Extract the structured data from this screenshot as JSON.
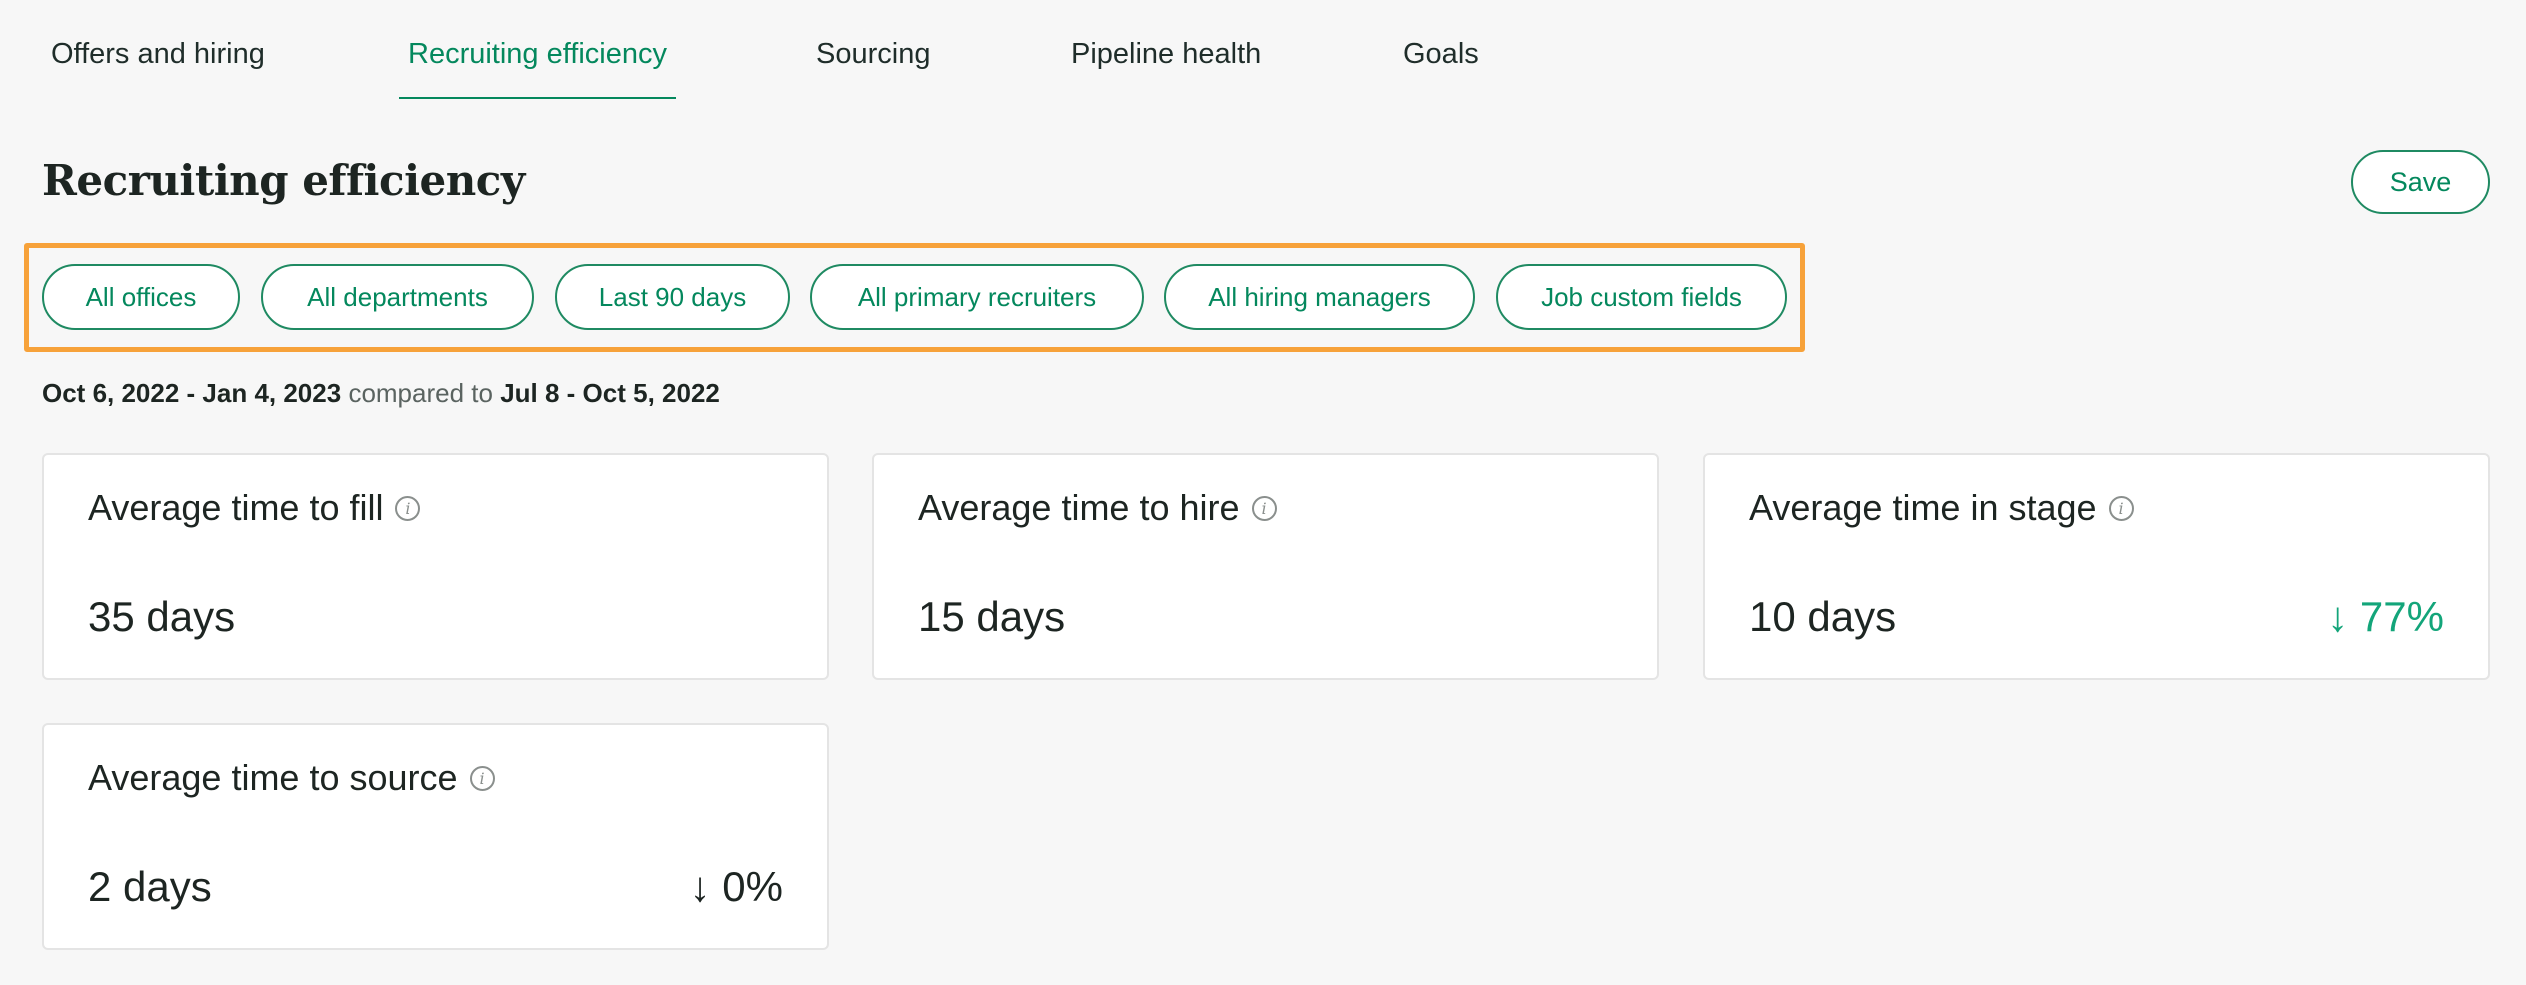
{
  "tabs": [
    {
      "label": "Offers and hiring",
      "active": false
    },
    {
      "label": "Recruiting efficiency",
      "active": true
    },
    {
      "label": "Sourcing",
      "active": false
    },
    {
      "label": "Pipeline health",
      "active": false
    },
    {
      "label": "Goals",
      "active": false
    }
  ],
  "page": {
    "title": "Recruiting efficiency",
    "save_label": "Save"
  },
  "filters": [
    {
      "label": "All offices"
    },
    {
      "label": "All departments"
    },
    {
      "label": "Last 90 days"
    },
    {
      "label": "All primary recruiters"
    },
    {
      "label": "All hiring managers"
    },
    {
      "label": "Job custom fields"
    }
  ],
  "date_range": {
    "current": "Oct 6, 2022 - Jan 4, 2023",
    "separator": "compared to",
    "previous": "Jul 8 - Oct 5, 2022"
  },
  "metrics": [
    {
      "title": "Average time to fill",
      "value": "35 days",
      "change": "",
      "change_color": "#1d2522"
    },
    {
      "title": "Average time to hire",
      "value": "15 days",
      "change": "",
      "change_color": "#1d2522"
    },
    {
      "title": "Average time in stage",
      "value": "10 days",
      "change": "↓ 77%",
      "change_color": "#13a57a"
    },
    {
      "title": "Average time to source",
      "value": "2 days",
      "change": "↓ 0%",
      "change_color": "#1d2522"
    }
  ],
  "colors": {
    "accent": "#04885d",
    "highlight_border": "#f7a23a",
    "positive_change": "#13a57a"
  },
  "icons": {
    "info": "info-icon"
  }
}
